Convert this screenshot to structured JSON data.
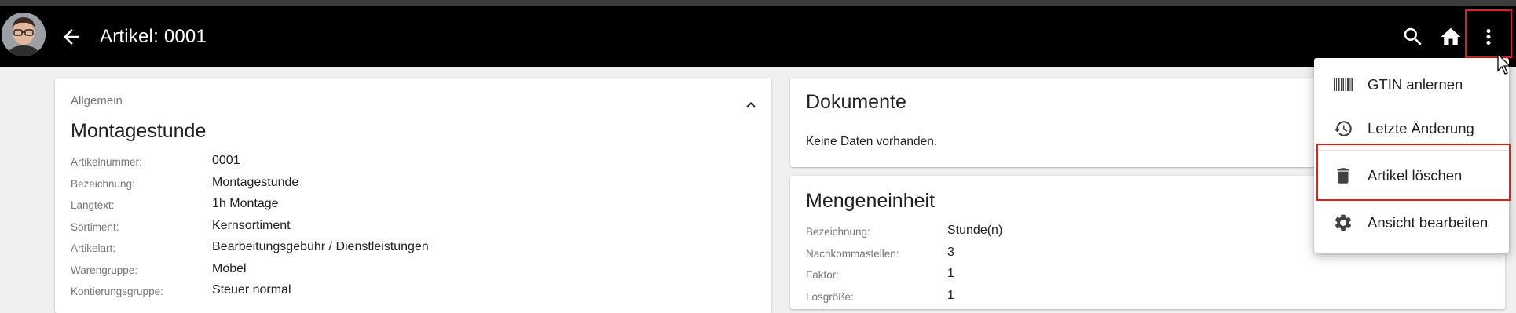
{
  "appbar": {
    "title": "Artikel: 0001",
    "icons": [
      "arrow-back-icon",
      "search-icon",
      "home-icon",
      "more-vert-icon"
    ]
  },
  "general": {
    "section_label": "Allgemein",
    "heading": "Montagestunde",
    "rows": [
      {
        "label": "Artikelnummer:",
        "value": "0001"
      },
      {
        "label": "Bezeichnung:",
        "value": "Montagestunde"
      },
      {
        "label": "Langtext:",
        "value": "1h Montage"
      },
      {
        "label": "Sortiment:",
        "value": "Kernsortiment"
      },
      {
        "label": "Artikelart:",
        "value": "Bearbeitungsgebühr / Dienstleistungen"
      },
      {
        "label": "Warengruppe:",
        "value": "Möbel"
      },
      {
        "label": "Kontierungsgruppe:",
        "value": "Steuer normal"
      }
    ]
  },
  "documents": {
    "title": "Dokumente",
    "empty_text": "Keine Daten vorhanden."
  },
  "units": {
    "title": "Mengeneinheit",
    "rows": [
      {
        "label": "Bezeichnung:",
        "value": "Stunde(n)"
      },
      {
        "label": "Nachkommastellen:",
        "value": "3"
      },
      {
        "label": "Faktor:",
        "value": "1"
      },
      {
        "label": "Losgröße:",
        "value": "1"
      }
    ]
  },
  "menu": {
    "items": [
      {
        "label": "GTIN anlernen",
        "icon": "barcode-icon"
      },
      {
        "label": "Letzte Änderung",
        "icon": "history-icon"
      },
      {
        "label": "Artikel löschen",
        "icon": "delete-icon"
      },
      {
        "label": "Ansicht bearbeiten",
        "icon": "settings-icon"
      }
    ]
  },
  "colors": {
    "appbar_bg": "#000000",
    "highlight_border": "#e0201b",
    "secondary_text": "#757575"
  }
}
